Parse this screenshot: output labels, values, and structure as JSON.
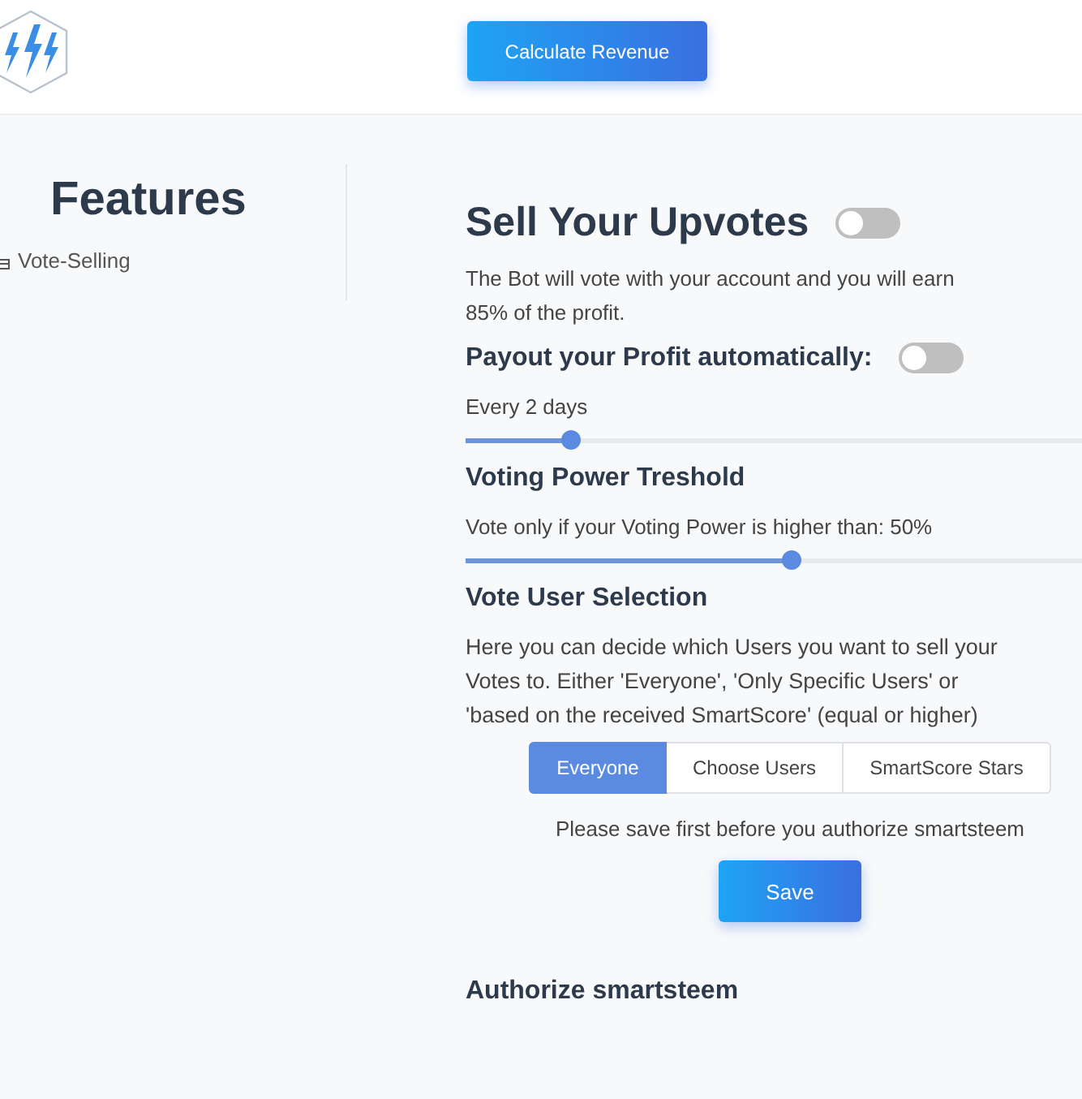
{
  "header": {
    "button": "Calculate Revenue"
  },
  "sidebar": {
    "title": "Features",
    "items": [
      {
        "label": "Vote-Selling",
        "selected": false
      }
    ]
  },
  "main": {
    "title": "Sell Your Upvotes",
    "enabled": false,
    "description": "The Bot will vote with your account and you will earn 85% of the profit.",
    "payout": {
      "label": "Payout your Profit automatically:",
      "on": false,
      "interval": "Every 2 days",
      "level": 0.17
    },
    "threshold": {
      "title": "Voting Power Treshold",
      "text": "Vote only if your Voting Power is higher than: 50%",
      "level": 0.53
    },
    "selection": {
      "title": "Vote User Selection",
      "text": "Here you can decide which Users you want to sell your Votes to. Either 'Everyone', 'Only Specific Users' or 'based on the received SmartScore' (equal or higher)",
      "options": [
        {
          "label": "Everyone",
          "selected": true
        },
        {
          "label": "Choose Users",
          "selected": false
        },
        {
          "label": "SmartScore Stars",
          "selected": false
        }
      ]
    },
    "notice": "Please save first before you authorize smartsteem",
    "save": "Save",
    "next_heading": "Authorize smartsteem"
  }
}
